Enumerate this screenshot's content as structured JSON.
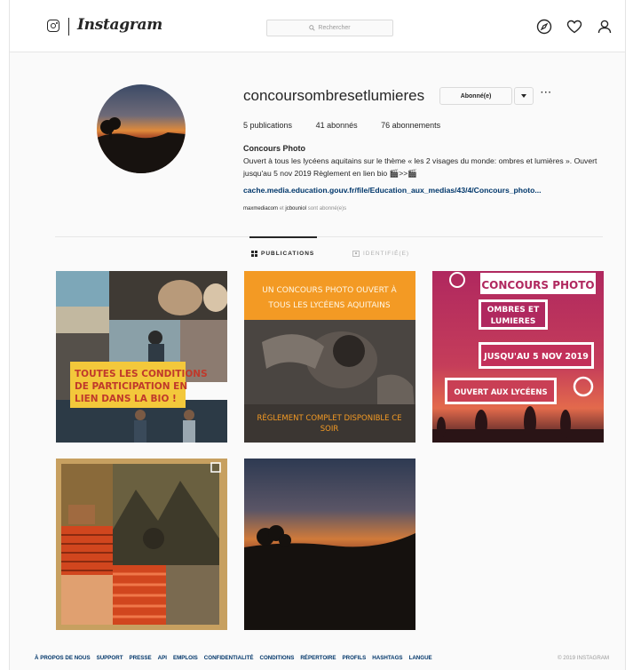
{
  "header": {
    "brand": "Instagram",
    "search_placeholder": "Rechercher",
    "icons": [
      "instagram-glyph-icon",
      "search-icon",
      "explore-compass-icon",
      "heart-icon",
      "profile-person-icon"
    ]
  },
  "profile": {
    "username": "concoursombresetlumieres",
    "follow_button": "Abonné(e)",
    "stats": {
      "publications": "5 publications",
      "followers": "41 abonnés",
      "following": "76 abonnements"
    },
    "bio_title": "Concours Photo",
    "bio_text": "Ouvert à tous les lycéens aquitains sur le thème « les 2 visages du monde: ombres et lumières ». Ouvert jusqu'au 5 nov 2019 Règlement en lien bio 🎬>>🎬",
    "bio_link": "cache.media.education.gouv.fr/file/Education_aux_medias/43/4/Concours_photo...",
    "followed_by": {
      "user1": "maxmediacom",
      "connector": "et",
      "user2": "jcbouniol",
      "suffix": "sont abonné(e)s"
    }
  },
  "tabs": [
    {
      "label": "PUBLICATIONS",
      "active": true
    },
    {
      "label": "IDENTIFIÉ(E)",
      "active": false
    }
  ],
  "posts": [
    {
      "id": "post-1",
      "text": [
        "TOUTES LES CONDITIONS",
        "DE PARTICIPATION EN",
        "LIEN DANS LA BIO !"
      ]
    },
    {
      "id": "post-2",
      "text": [
        "UN CONCOURS PHOTO OUVERT À",
        "TOUS LES LYCÉENS AQUITAINS",
        "RÈGLEMENT COMPLET DISPONIBLE CE",
        "SOIR"
      ]
    },
    {
      "id": "post-3",
      "text": [
        "CONCOURS PHOTO",
        "OMBRES ET",
        "LUMIERES",
        "JUSQU'AU 5 NOV 2019",
        "OUVERT AUX LYCÉENS"
      ]
    },
    {
      "id": "post-4",
      "text": []
    },
    {
      "id": "post-5",
      "text": []
    }
  ],
  "footer": {
    "links": [
      "À PROPOS DE NOUS",
      "SUPPORT",
      "PRESSE",
      "API",
      "EMPLOIS",
      "CONFIDENTIALITÉ",
      "CONDITIONS",
      "RÉPERTOIRE",
      "PROFILS",
      "HASHTAGS",
      "LANGUE"
    ],
    "copyright": "© 2019 INSTAGRAM"
  },
  "colors": {
    "link_blue": "#00376b",
    "footer_blue": "#003569",
    "post2_banner": "#f39a24",
    "post3_magenta": "#b0285f"
  }
}
